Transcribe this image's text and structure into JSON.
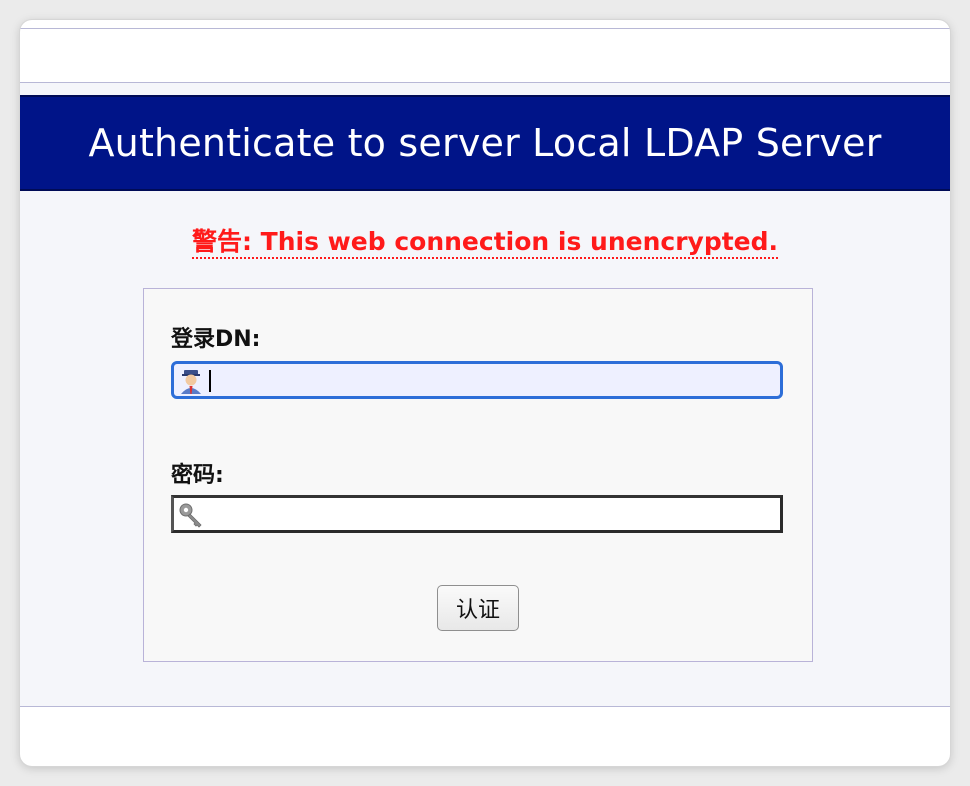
{
  "page": {
    "banner_title": "Authenticate to server Local LDAP Server",
    "warning": "警告: This web connection is unencrypted."
  },
  "form": {
    "login_label": "登录DN:",
    "login_value": "",
    "login_icon": "user-icon",
    "password_label": "密码:",
    "password_value": "",
    "password_icon": "key-icon",
    "submit_label": "认证"
  },
  "colors": {
    "banner_bg": "#001488",
    "banner_text": "#ffffff",
    "warning_text": "#ff1a1a",
    "focus_border": "#2d6ed8"
  }
}
